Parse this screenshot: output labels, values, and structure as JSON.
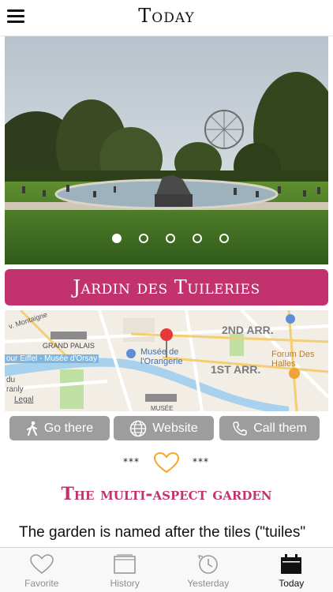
{
  "header": {
    "title": "Today",
    "menu_icon": "hamburger-menu-icon"
  },
  "carousel": {
    "slide_count": 5,
    "active_index": 0
  },
  "place": {
    "name": "Jardin des Tuileries"
  },
  "map": {
    "labels": {
      "montaigne": "v. Montaigne",
      "grand_palais": "GRAND PALAIS",
      "musee_orangerie": "Musée de\nl'Orangerie",
      "arr2": "2ND ARR.",
      "arr1": "1ST ARR.",
      "forum": "Forum Des\nHalles",
      "tour_eiffel": "our Eiffel - Musée d'Orsay",
      "du": "du",
      "branly": "ranly",
      "legal": "Legal",
      "musee": "MUSÉE"
    }
  },
  "actions": {
    "go_there": "Go there",
    "website": "Website",
    "call": "Call them"
  },
  "favorite": {
    "stars_left": "***",
    "stars_right": "***"
  },
  "article": {
    "section_title": "The multi-aspect garden",
    "body": "The garden is named after the tiles (\"tuiles\" in French) factory that is located ahead of"
  },
  "tabs": [
    {
      "label": "Favorite",
      "icon": "heart-icon"
    },
    {
      "label": "History",
      "icon": "book-icon"
    },
    {
      "label": "Yesterday",
      "icon": "clock-icon"
    },
    {
      "label": "Today",
      "icon": "calendar-icon"
    }
  ],
  "colors": {
    "accent": "#c2336d",
    "button_gray": "#9d9d9d",
    "heart": "#f5a623"
  }
}
